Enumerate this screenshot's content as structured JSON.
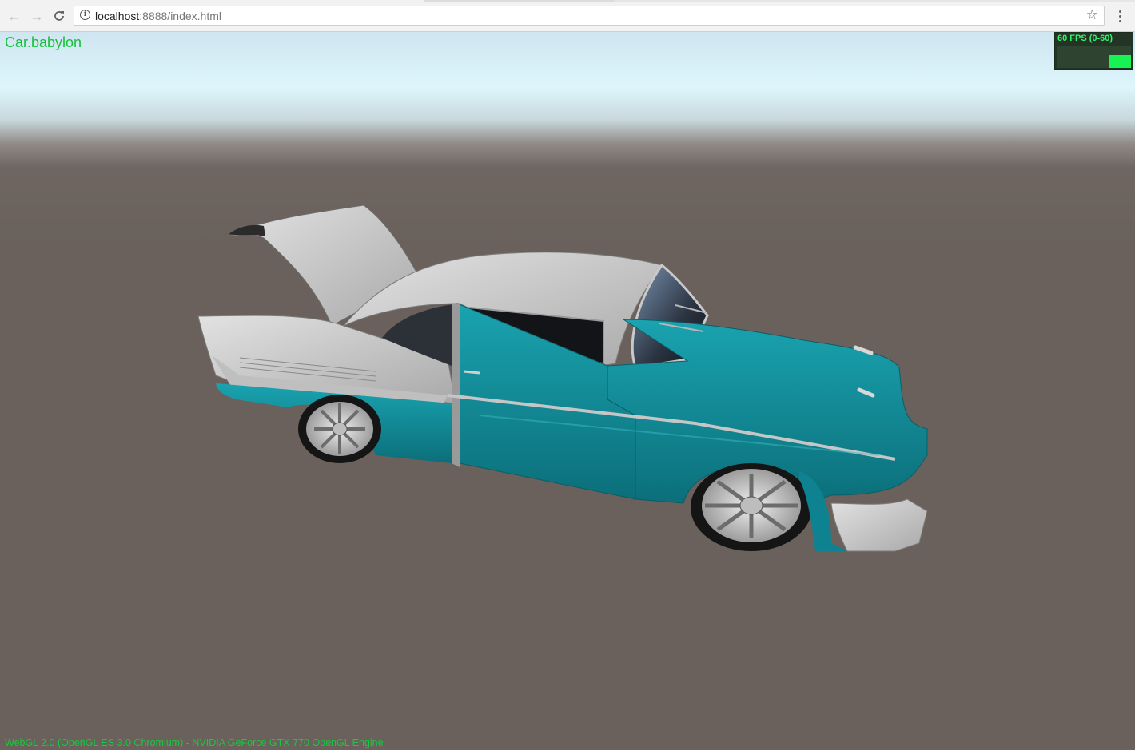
{
  "browser": {
    "url_host": "localhost",
    "url_rest": ":8888/index.html",
    "back_icon": "arrow-left",
    "forward_icon": "arrow-right",
    "reload_icon": "reload",
    "info_icon": "info",
    "bookmark_icon": "star",
    "menu_icon": "vertical-dots"
  },
  "scene": {
    "title": "Car.babylon",
    "fps_label": "60 FPS (0-60)",
    "fps_value": 60,
    "fps_max": 60,
    "status": "WebGL 2.0 (OpenGL ES 3.0 Chromium) - NVIDIA GeForce GTX 770 OpenGL Engine"
  },
  "colors": {
    "overlay_text": "#15c13a",
    "fps_text": "#2ff56b",
    "ground": "#6a615c",
    "car_body": "#0f8d9a",
    "car_roof": "#c8c8c8"
  }
}
